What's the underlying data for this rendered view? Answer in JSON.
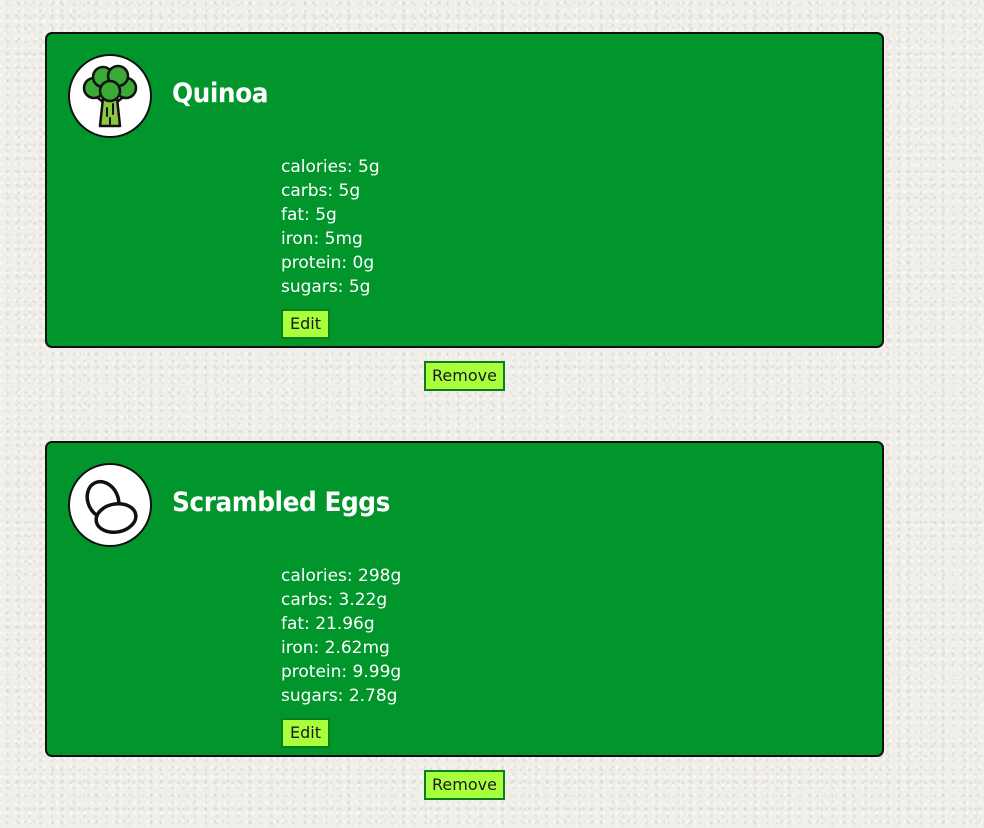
{
  "foods": [
    {
      "icon": "broccoli-icon",
      "name": "Quinoa",
      "nutrients": [
        "calories: 5g",
        "carbs: 5g",
        "fat: 5g",
        "iron: 5mg",
        "protein: 0g",
        "sugars: 5g"
      ],
      "edit_label": "Edit",
      "remove_label": "Remove"
    },
    {
      "icon": "egg-icon",
      "name": "Scrambled Eggs",
      "nutrients": [
        "calories: 298g",
        "carbs: 3.22g",
        "fat: 21.96g",
        "iron: 2.62mg",
        "protein: 9.99g",
        "sugars: 2.78g"
      ],
      "edit_label": "Edit",
      "remove_label": "Remove"
    }
  ],
  "colors": {
    "card_bg": "#00962b",
    "button_bg": "#a8ff3c",
    "page_bg": "#efeee8"
  }
}
